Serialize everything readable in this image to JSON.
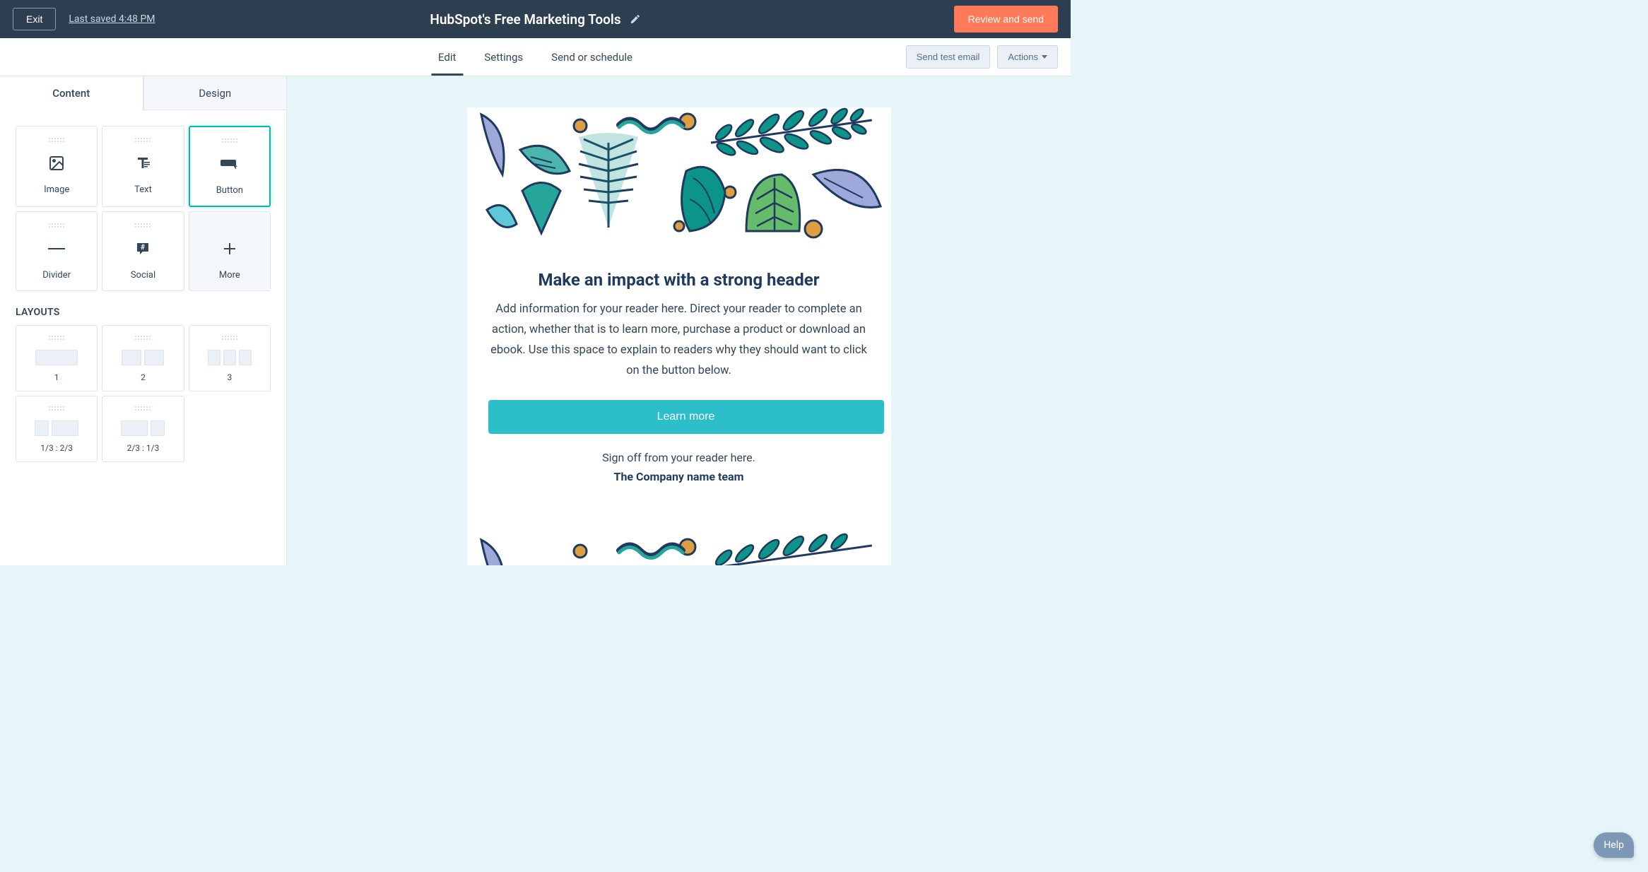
{
  "topbar": {
    "exit": "Exit",
    "last_saved": "Last saved 4:48 PM",
    "title": "HubSpot's Free Marketing Tools",
    "review": "Review and send"
  },
  "secbar": {
    "tabs": {
      "edit": "Edit",
      "settings": "Settings",
      "send": "Send or schedule"
    },
    "send_test": "Send test email",
    "actions": "Actions"
  },
  "sidebar": {
    "tabs": {
      "content": "Content",
      "design": "Design"
    },
    "blocks": {
      "image": "Image",
      "text": "Text",
      "button": "Button",
      "divider": "Divider",
      "social": "Social",
      "more": "More"
    },
    "layouts_header": "LAYOUTS",
    "layouts": {
      "l1": "1",
      "l2": "2",
      "l3": "3",
      "l4": "1/3 : 2/3",
      "l5": "2/3 : 1/3"
    }
  },
  "email": {
    "heading": "Make an impact with a strong header",
    "paragraph": "Add information for your reader here. Direct your reader to complete an action, whether that is to learn more, purchase a product or download an ebook. Use this space to explain to readers why they should want to click on the button below.",
    "cta": "Learn more",
    "signoff": "Sign off from your reader here.",
    "team": "The Company name team"
  },
  "help": "Help"
}
